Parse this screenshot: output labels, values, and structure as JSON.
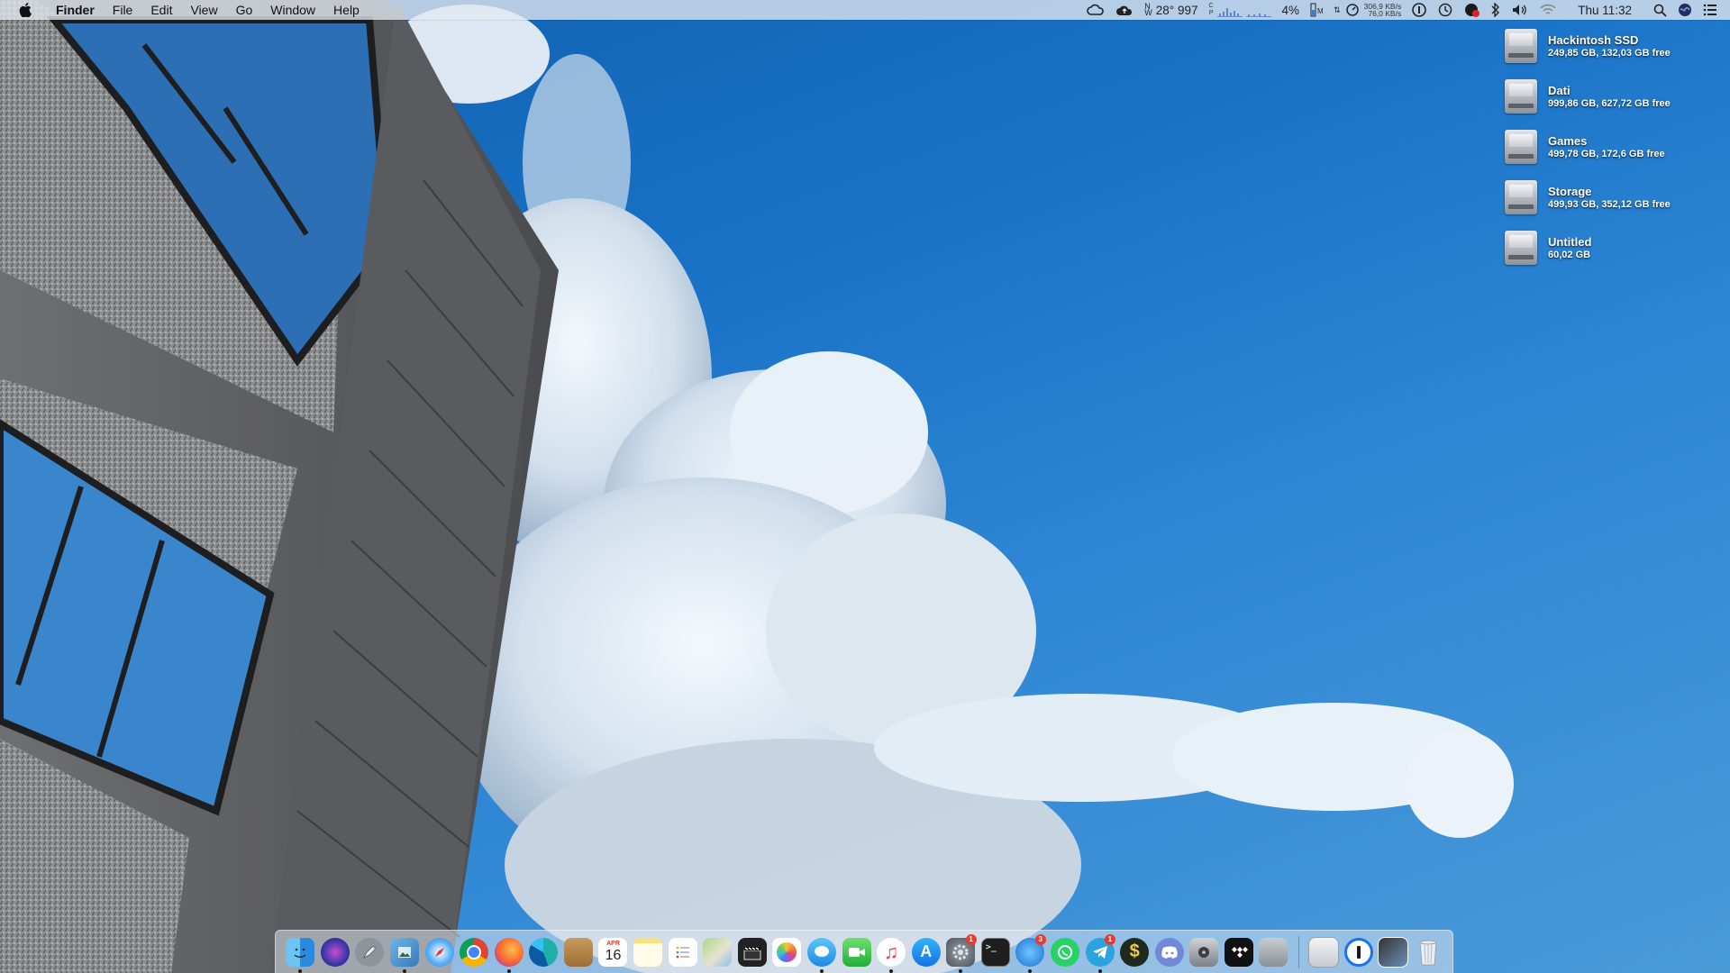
{
  "menubar": {
    "app_name": "Finder",
    "menus": [
      "File",
      "Edit",
      "View",
      "Go",
      "Window",
      "Help"
    ],
    "weather": "28° 997",
    "cpu_percent": "4%",
    "net_up": "306,9 KB/s",
    "net_down": "76,0 KB/s",
    "clock": "Thu 11:32"
  },
  "volumes": [
    {
      "name": "Hackintosh SSD",
      "info": "249,85 GB, 132,03 GB free"
    },
    {
      "name": "Dati",
      "info": "999,86 GB, 627,72 GB free"
    },
    {
      "name": "Games",
      "info": "499,78 GB, 172,6 GB free"
    },
    {
      "name": "Storage",
      "info": "499,93 GB, 352,12 GB free"
    },
    {
      "name": "Untitled",
      "info": "60,02 GB"
    }
  ],
  "dock": {
    "calendar_month": "APR",
    "calendar_day": "16",
    "badges": {
      "system_preferences": "1",
      "tweetbot": "3",
      "telegram": "1"
    }
  },
  "colors": {
    "menu_bg": "#e1e8f0",
    "sky": "#1a73c7",
    "badge": "#e63b2e"
  }
}
